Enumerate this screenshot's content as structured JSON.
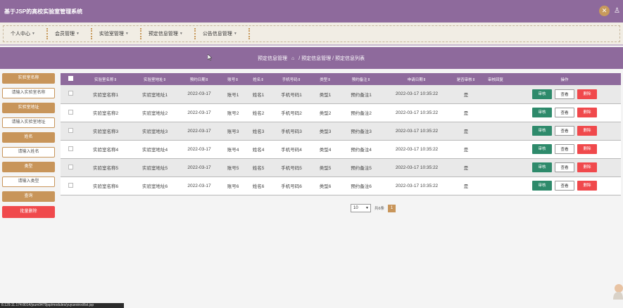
{
  "app": {
    "title": "基于JSP的高校实验室管理系统"
  },
  "topbar": {
    "close_icon": "close-icon",
    "user_icon": "user-icon",
    "user_glyph": "♙"
  },
  "nav": {
    "items": [
      {
        "label": "个人中心"
      },
      {
        "label": "会员管理"
      },
      {
        "label": "实验室管理"
      },
      {
        "label": "预定信息管理"
      },
      {
        "label": "公告信息管理"
      }
    ]
  },
  "breadcrumb": {
    "home_icon": "home-icon",
    "root": "预定信息管理",
    "path": "/ 预定信息管理 / 预定信息列表"
  },
  "sidebar": {
    "filters": [
      {
        "label": "实验室名称",
        "placeholder": "请输入实验室名称"
      },
      {
        "label": "实验室地址",
        "placeholder": "请输入实验室地址"
      },
      {
        "label": "姓名",
        "placeholder": "请输入姓名"
      },
      {
        "label": "类型",
        "placeholder": "请输入类型"
      }
    ],
    "search_label": "查询",
    "batch_delete_label": "批量删除"
  },
  "table": {
    "headers": [
      "实验室名称⇕",
      "实验室地址⇕",
      "预约日期⇕",
      "账号⇕",
      "姓名⇕",
      "手机号码⇕",
      "类型⇕",
      "预约备注⇕",
      "申请日期⇕",
      "是否审核⇕",
      "审核回复",
      "操作"
    ],
    "rows": [
      [
        "实验室名称1",
        "实验室地址1",
        "2022-03-17",
        "账号1",
        "姓名1",
        "手机号码1",
        "类型1",
        "预约备注1",
        "2022-03-17 10:35:22",
        "是",
        ""
      ],
      [
        "实验室名称2",
        "实验室地址2",
        "2022-03-17",
        "账号2",
        "姓名2",
        "手机号码2",
        "类型2",
        "预约备注2",
        "2022-03-17 10:35:22",
        "是",
        ""
      ],
      [
        "实验室名称3",
        "实验室地址3",
        "2022-03-17",
        "账号3",
        "姓名3",
        "手机号码3",
        "类型3",
        "预约备注3",
        "2022-03-17 10:35:22",
        "是",
        ""
      ],
      [
        "实验室名称4",
        "实验室地址4",
        "2022-03-17",
        "账号4",
        "姓名4",
        "手机号码4",
        "类型4",
        "预约备注4",
        "2022-03-17 10:35:22",
        "是",
        ""
      ],
      [
        "实验室名称5",
        "实验室地址5",
        "2022-03-17",
        "账号5",
        "姓名5",
        "手机号码5",
        "类型5",
        "预约备注5",
        "2022-03-17 10:35:22",
        "是",
        ""
      ],
      [
        "实验室名称6",
        "实验室地址6",
        "2022-03-17",
        "账号6",
        "姓名6",
        "手机号码6",
        "类型6",
        "预约备注6",
        "2022-03-17 10:35:22",
        "是",
        ""
      ]
    ],
    "ops": {
      "audit": "审核",
      "view": "查看",
      "delete": "删除"
    }
  },
  "pagination": {
    "page_size": "10",
    "total": "共6条",
    "current_page": "1"
  },
  "status_bar": {
    "url": "8.129.11.174:8014/jsum9479jsp/modules/yuyuexinxi/list.jsp"
  },
  "colors": {
    "primary": "#8e6a9c",
    "accent": "#c8955a",
    "danger": "#f0494c",
    "success": "#2e8a6b"
  }
}
